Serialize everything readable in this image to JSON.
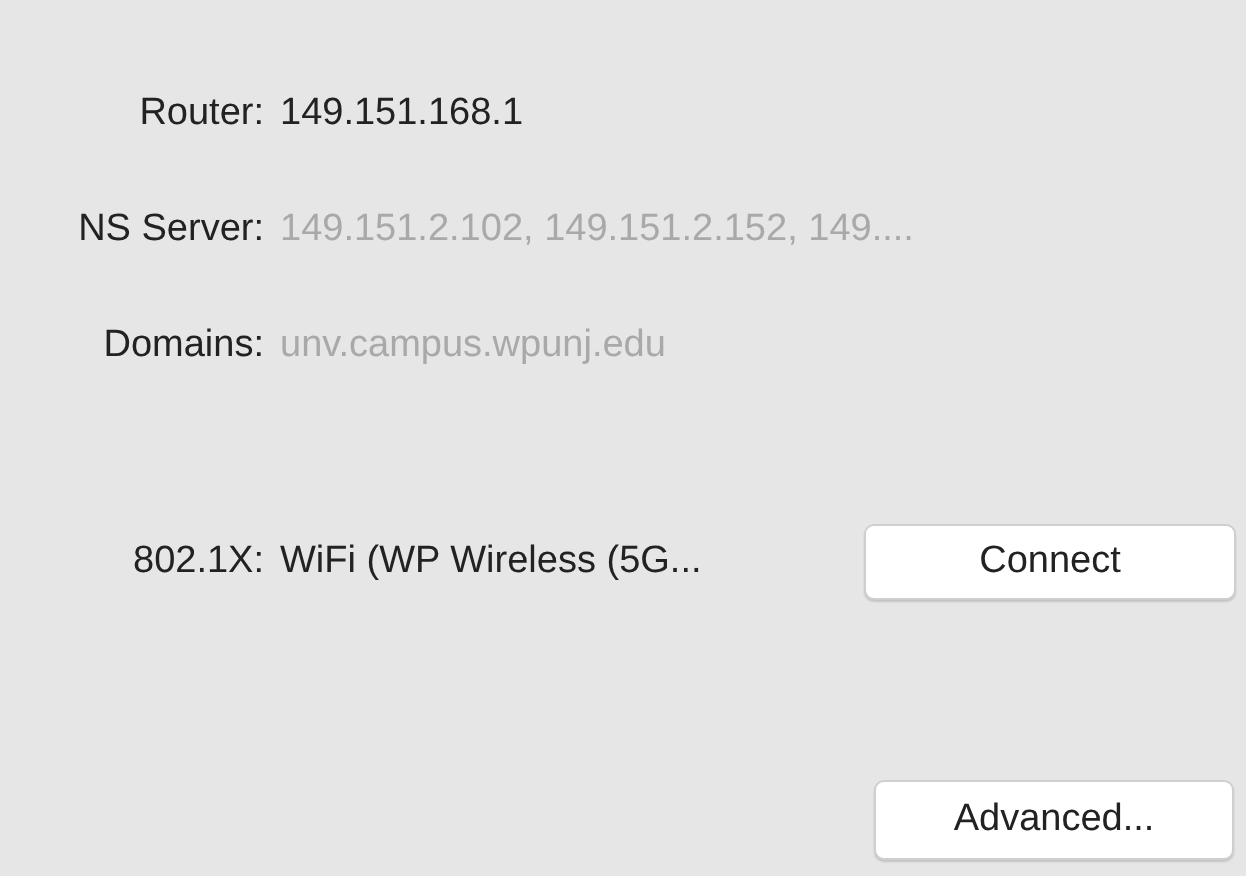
{
  "fields": [
    {
      "label": "Router:",
      "value": "149.151.168.1",
      "dimmed": false
    },
    {
      "label": "NS Server:",
      "value": "149.151.2.102, 149.151.2.152, 149....",
      "dimmed": true
    },
    {
      "label": "Domains:",
      "value": "unv.campus.wpunj.edu",
      "dimmed": true
    }
  ],
  "auth": {
    "label": "802.1X:",
    "value": "WiFi (WP Wireless (5G...",
    "button": "Connect"
  },
  "advanced_button": "Advanced..."
}
